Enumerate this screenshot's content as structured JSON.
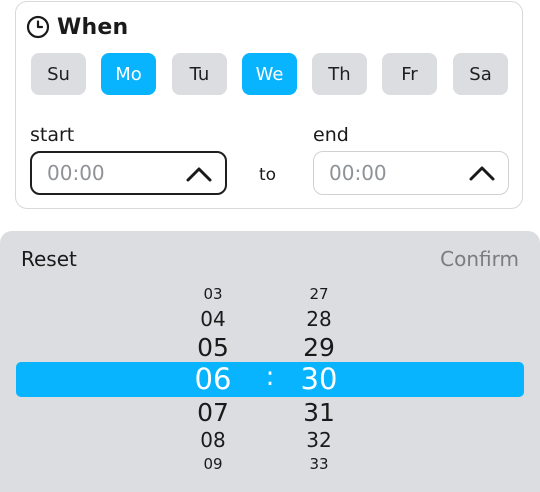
{
  "header": {
    "title": "When",
    "icon": "clock-icon"
  },
  "days": [
    {
      "label": "Su",
      "selected": false
    },
    {
      "label": "Mo",
      "selected": true
    },
    {
      "label": "Tu",
      "selected": false
    },
    {
      "label": "We",
      "selected": true
    },
    {
      "label": "Th",
      "selected": false
    },
    {
      "label": "Fr",
      "selected": false
    },
    {
      "label": "Sa",
      "selected": false
    }
  ],
  "start": {
    "label": "start",
    "value": "00:00"
  },
  "separator": "to",
  "end": {
    "label": "end",
    "value": "00:00"
  },
  "picker": {
    "reset_label": "Reset",
    "confirm_label": "Confirm",
    "colon": ":",
    "hours": [
      "03",
      "04",
      "05",
      "06",
      "07",
      "08",
      "09"
    ],
    "minutes": [
      "27",
      "28",
      "29",
      "30",
      "31",
      "32",
      "33"
    ],
    "selected_hour": "06",
    "selected_minute": "30"
  },
  "colors": {
    "accent": "#09b4ff",
    "panel": "#dcdde0"
  }
}
